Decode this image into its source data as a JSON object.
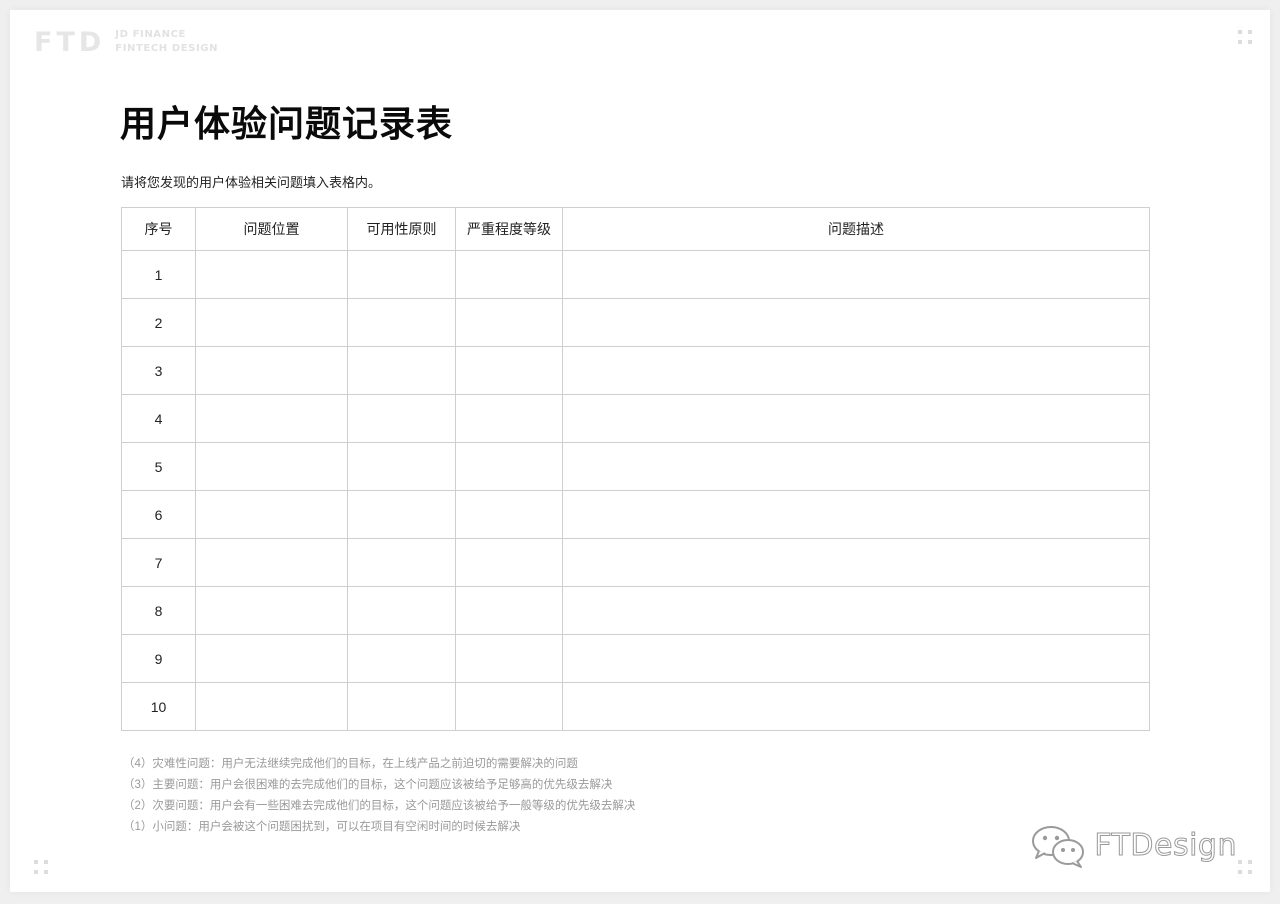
{
  "brand": {
    "mark": "FTD",
    "line1": "JD FINANCE",
    "line2": "FINTECH DESIGN"
  },
  "title": "用户体验问题记录表",
  "subtitle": "请将您发现的用户体验相关问题填入表格内。",
  "table": {
    "headers": [
      "序号",
      "问题位置",
      "可用性原则",
      "严重程度等级",
      "问题描述"
    ],
    "rows": [
      {
        "index": "1",
        "location": "",
        "principle": "",
        "severity": "",
        "description": ""
      },
      {
        "index": "2",
        "location": "",
        "principle": "",
        "severity": "",
        "description": ""
      },
      {
        "index": "3",
        "location": "",
        "principle": "",
        "severity": "",
        "description": ""
      },
      {
        "index": "4",
        "location": "",
        "principle": "",
        "severity": "",
        "description": ""
      },
      {
        "index": "5",
        "location": "",
        "principle": "",
        "severity": "",
        "description": ""
      },
      {
        "index": "6",
        "location": "",
        "principle": "",
        "severity": "",
        "description": ""
      },
      {
        "index": "7",
        "location": "",
        "principle": "",
        "severity": "",
        "description": ""
      },
      {
        "index": "8",
        "location": "",
        "principle": "",
        "severity": "",
        "description": ""
      },
      {
        "index": "9",
        "location": "",
        "principle": "",
        "severity": "",
        "description": ""
      },
      {
        "index": "10",
        "location": "",
        "principle": "",
        "severity": "",
        "description": ""
      }
    ]
  },
  "notes": [
    "（4）灾难性问题：用户无法继续完成他们的目标，在上线产品之前迫切的需要解决的问题",
    "（3）主要问题：用户会很困难的去完成他们的目标，这个问题应该被给予足够高的优先级去解决",
    "（2）次要问题：用户会有一些困难去完成他们的目标，这个问题应该被给予一般等级的优先级去解决",
    "（1）小问题：用户会被这个问题困扰到，可以在项目有空闲时间的时候去解决"
  ],
  "watermark": {
    "icon": "wechat-icon",
    "text": "FTDesign"
  },
  "colors": {
    "border": "#cfcfcf",
    "note_text": "#9a9a9a",
    "title_text": "#0a0a0a"
  }
}
